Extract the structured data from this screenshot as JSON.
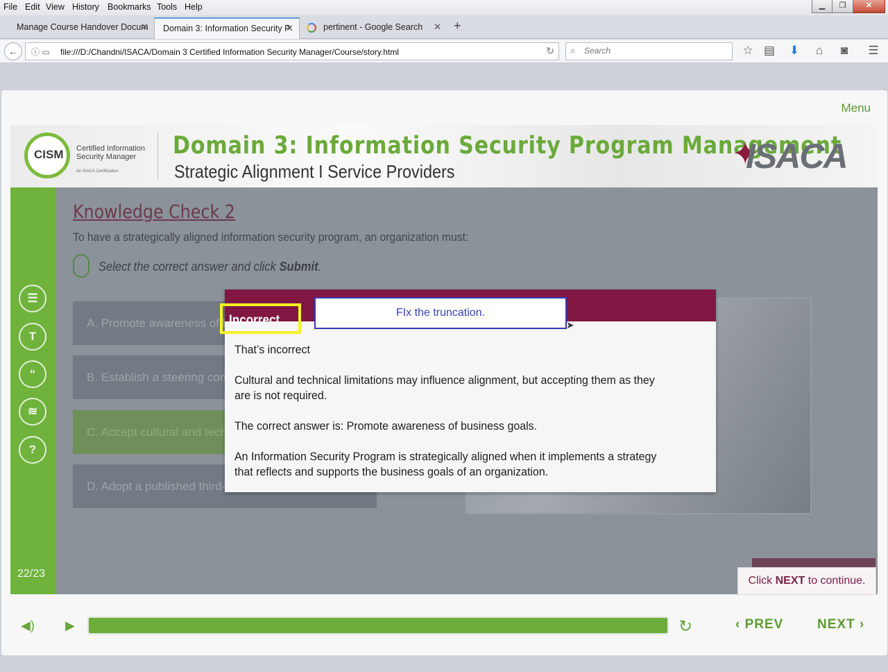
{
  "browser": {
    "menu": [
      "File",
      "Edit",
      "View",
      "History",
      "Bookmarks",
      "Tools",
      "Help"
    ],
    "window_buttons": {
      "minimize": "▁",
      "restore": "❐",
      "close": "✕"
    },
    "tabs": [
      {
        "label": "Manage Course Handover Docum",
        "active": false
      },
      {
        "label": "Domain 3: Information Security P",
        "active": true
      },
      {
        "label": "pertinent - Google Search",
        "active": false
      }
    ],
    "new_tab": "+",
    "url": "file:///D:/Chandni/ISACA/Domain 3 Certified Information Security Manager/Course/story.html",
    "search_placeholder": "Search"
  },
  "course": {
    "menu_label": "Menu",
    "logo": {
      "cism": "CISM",
      "line1": "Certified Information",
      "line2": "Security Manager",
      "line3": "An ISACA Certification"
    },
    "banner_title": "Domain 3: Information Security Program Management",
    "banner_subtitle": "Strategic Alignment I Service Providers",
    "isaca_logo": "ISACA",
    "sidebar_icons": [
      "document-icon",
      "glossary-icon",
      "quote-icon",
      "layers-icon",
      "help-icon"
    ],
    "slide_counter": "22/23",
    "knowledge_check": {
      "title": "Knowledge Check 2",
      "question": "To have a strategically aligned information security program, an organization must:",
      "instruction_prefix": "Select the correct answer and click ",
      "instruction_action": "Submit",
      "instruction_suffix": ".",
      "options": [
        "A. Promote awareness of b",
        "B. Establish a steering com",
        "C. Accept cultural and techn",
        "D. Adopt a published third-p"
      ]
    },
    "feedback": {
      "header": "Incorrect",
      "lines": [
        "That’s incorrect",
        "Cultural and technical limitations may influence alignment, but accepting them as they are is not required.",
        "The correct answer is: Promote awareness of business goals.",
        "An Information Security Program is strategically aligned when it implements a strategy that reflects and supports the business goals of an organization."
      ]
    },
    "annotation": "FIx the truncation.",
    "continue_prefix": "Click ",
    "continue_action": "NEXT",
    "continue_suffix": " to continue.",
    "controls": {
      "prev_label": "PREV",
      "next_label": "NEXT",
      "progress": 1.0
    }
  },
  "colors": {
    "brand_green": "#6fb23c",
    "dialog_header": "#801743",
    "annotation_border": "#3737b6",
    "highlight": "#f5f228"
  }
}
